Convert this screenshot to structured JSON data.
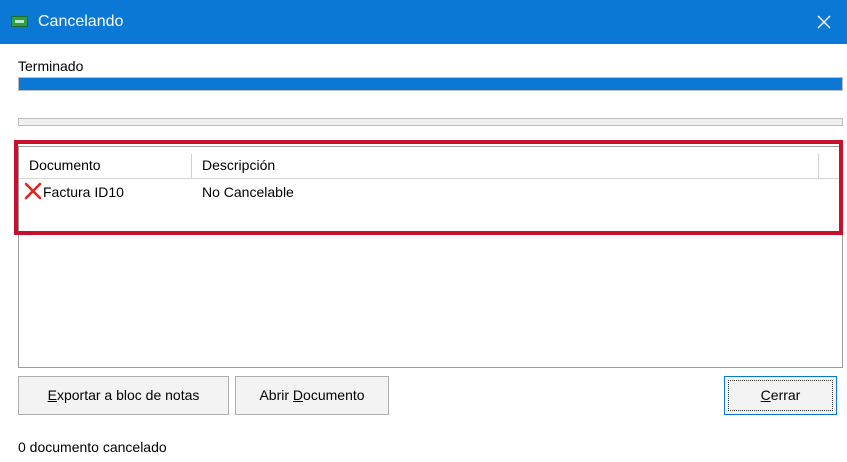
{
  "window": {
    "title": "Cancelando"
  },
  "progress": {
    "status_label": "Terminado",
    "primary_fraction": 1.0,
    "secondary_fraction": 0.0
  },
  "table": {
    "columns": [
      "Documento",
      "Descripción"
    ],
    "rows": [
      {
        "icon": "error-x-icon",
        "documento": "Factura ID10",
        "descripcion": "No Cancelable"
      }
    ]
  },
  "buttons": {
    "export": {
      "pre": "",
      "mnemonic": "E",
      "post": "xportar a bloc de notas"
    },
    "open": {
      "pre": "Abrir ",
      "mnemonic": "D",
      "post": "ocumento"
    },
    "close": {
      "pre": "",
      "mnemonic": "C",
      "post": "errar"
    }
  },
  "footer": {
    "status": "0 documento cancelado"
  },
  "colors": {
    "titlebar": "#0a78d4",
    "highlight": "#c8102e",
    "progress": "#0a78d4"
  }
}
